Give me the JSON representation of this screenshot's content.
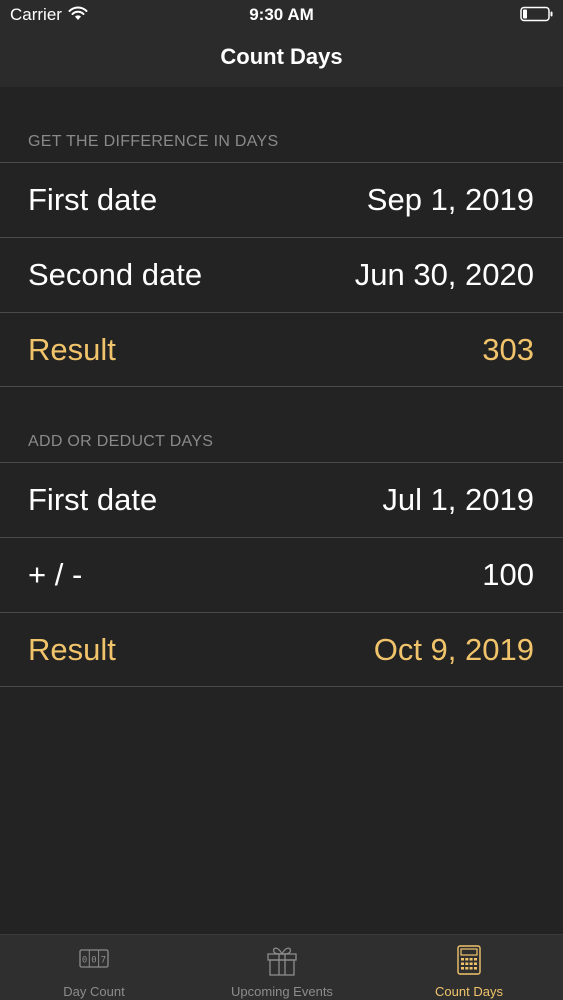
{
  "status_bar": {
    "carrier": "Carrier",
    "time": "9:30 AM",
    "icons": [
      "wifi-icon",
      "battery-icon"
    ]
  },
  "nav": {
    "title": "Count Days"
  },
  "sections": [
    {
      "header": "GET THE DIFFERENCE IN DAYS",
      "rows": [
        {
          "label": "First date",
          "value": "Sep 1, 2019"
        },
        {
          "label": "Second date",
          "value": "Jun 30, 2020"
        },
        {
          "label": "Result",
          "value": "303"
        }
      ]
    },
    {
      "header": "ADD OR DEDUCT DAYS",
      "rows": [
        {
          "label": "First date",
          "value": "Jul 1, 2019"
        },
        {
          "label": "+ / -",
          "value": "100"
        },
        {
          "label": "Result",
          "value": "Oct 9, 2019"
        }
      ]
    }
  ],
  "tab_bar": {
    "tabs": [
      {
        "label": "Day Count",
        "icon": "counter-icon",
        "active": false
      },
      {
        "label": "Upcoming Events",
        "icon": "gift-icon",
        "active": false
      },
      {
        "label": "Count Days",
        "icon": "calculator-icon",
        "active": true
      }
    ]
  },
  "colors": {
    "background": "#232323",
    "bar_background": "#2b2b2b",
    "accent": "#f1c46c",
    "separator": "#4a4a4a",
    "header_text": "#8a8a8a",
    "inactive_tab": "#8c8c8c"
  }
}
